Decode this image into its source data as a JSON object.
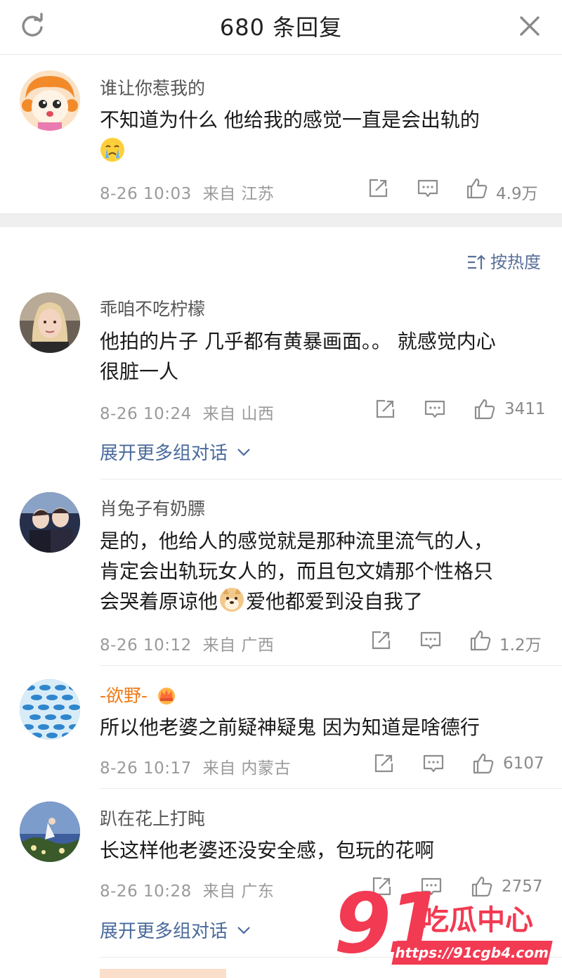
{
  "header": {
    "title": "680 条回复"
  },
  "sort_label": "按热度",
  "expand_label": "展开更多组对话",
  "main_comment": {
    "username": "谁让你惹我的",
    "text": "不知道为什么 他给我的感觉一直是会出轨的",
    "time": "8-26 10:03",
    "location": "来自 江苏",
    "likes": "4.9万"
  },
  "replies": [
    {
      "username": "乖咱不吃柠檬",
      "line1": "他拍的片子 几乎都有黄暴画面。。 就感觉内心",
      "line2": "很脏一人",
      "time": "8-26 10:24",
      "location": "来自 山西",
      "likes": "3411"
    },
    {
      "username": "肖兔子有奶膘",
      "line1": "是的，他给人的感觉就是那种流里流气的人，",
      "line2": "肯定会出轨玩女人的，而且包文婧那个性格只",
      "line3a": "会哭着原谅他",
      "line3b": "爱他都爱到没自我了",
      "time": "8-26 10:12",
      "location": "来自 广西",
      "likes": "1.2万"
    },
    {
      "username": "-欲野-",
      "line1": "所以他老婆之前疑神疑鬼 因为知道是啥德行",
      "time": "8-26 10:17",
      "location": "来自 内蒙古",
      "likes": "6107"
    },
    {
      "username": "趴在花上打盹",
      "line1": "长这样他老婆还没安全感，包玩的花啊",
      "time": "8-26 10:28",
      "location": "来自 广东",
      "likes": "2757"
    }
  ],
  "watermark": {
    "number": "91",
    "name": "吃瓜中心",
    "url": "https://91cgb4.com"
  },
  "icons": [
    "refresh-icon",
    "close-icon",
    "repost-icon",
    "comment-icon",
    "like-icon",
    "sort-icon",
    "chevron-down-icon",
    "crying-emoji",
    "doge-emoji",
    "crown-badge-icon"
  ],
  "colors": {
    "link": "#4a6a9c",
    "meta": "#9a9a9a",
    "watermark": "#f23a52",
    "vip_name": "#f07a17"
  }
}
